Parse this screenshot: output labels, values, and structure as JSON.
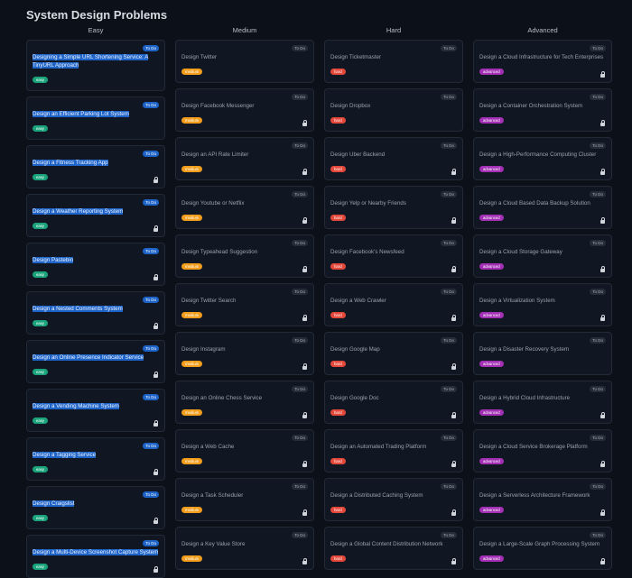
{
  "page_title": "System Design Problems",
  "todo_label": "To Do",
  "colors": {
    "easy": "#1ba47c",
    "medium": "#f29d1c",
    "hard": "#e4483b",
    "advanced": "#a22fb4"
  },
  "columns": [
    {
      "key": "easy",
      "heading": "Easy",
      "badge": "easy",
      "selected": true,
      "items": [
        {
          "title": "Designing a Simple URL Shortening Service: A TinyURL Approach",
          "locked": false
        },
        {
          "title": "Design an Efficient Parking Lot System",
          "locked": false
        },
        {
          "title": "Design a Fitness Tracking App",
          "locked": true
        },
        {
          "title": "Design a Weather Reporting System",
          "locked": true
        },
        {
          "title": "Design Pastebin",
          "locked": true
        },
        {
          "title": "Design a Nested Comments System",
          "locked": true
        },
        {
          "title": "Design an Online Presence Indicator Service",
          "locked": true
        },
        {
          "title": "Design a Vending Machine System",
          "locked": true
        },
        {
          "title": "Design a Tagging Service",
          "locked": true
        },
        {
          "title": "Design Craigslist",
          "locked": true
        },
        {
          "title": "Design a Multi-Device Screenshot Capture System",
          "locked": true
        }
      ]
    },
    {
      "key": "medium",
      "heading": "Medium",
      "badge": "medium",
      "selected": false,
      "items": [
        {
          "title": "Design Twitter",
          "locked": false
        },
        {
          "title": "Design Facebook Messenger",
          "locked": true
        },
        {
          "title": "Design an API Rate Limiter",
          "locked": true
        },
        {
          "title": "Design Youtube or Netflix",
          "locked": true
        },
        {
          "title": "Design Typeahead Suggestion",
          "locked": true
        },
        {
          "title": "Design Twitter Search",
          "locked": true
        },
        {
          "title": "Design Instagram",
          "locked": true
        },
        {
          "title": "Design an Online Chess Service",
          "locked": true
        },
        {
          "title": "Design a Web Cache",
          "locked": true
        },
        {
          "title": "Design a Task Scheduler",
          "locked": true
        },
        {
          "title": "Design a Key Value Store",
          "locked": true
        }
      ]
    },
    {
      "key": "hard",
      "heading": "Hard",
      "badge": "hard",
      "selected": false,
      "items": [
        {
          "title": "Design Ticketmaster",
          "locked": false
        },
        {
          "title": "Design Dropbox",
          "locked": false
        },
        {
          "title": "Design Uber Backend",
          "locked": true
        },
        {
          "title": "Design Yelp or Nearby Friends",
          "locked": true
        },
        {
          "title": "Design Facebook's Newsfeed",
          "locked": true
        },
        {
          "title": "Design a Web Crawler",
          "locked": true
        },
        {
          "title": "Design Google Map",
          "locked": true
        },
        {
          "title": "Design Google Doc",
          "locked": true
        },
        {
          "title": "Design an Automated Trading Platform",
          "locked": true
        },
        {
          "title": "Design a Distributed Caching System",
          "locked": true
        },
        {
          "title": "Design a Global Content Distribution Network",
          "locked": true
        }
      ]
    },
    {
      "key": "advanced",
      "heading": "Advanced",
      "badge": "advanced",
      "selected": false,
      "items": [
        {
          "title": "Design a Cloud Infrastructure for Tech Enterprises",
          "locked": true
        },
        {
          "title": "Design a Container Orchestration System",
          "locked": true
        },
        {
          "title": "Design a High-Performance Computing Cluster",
          "locked": true
        },
        {
          "title": "Design a Cloud Based Data Backup Solution",
          "locked": true
        },
        {
          "title": "Design a Cloud Storage Gateway",
          "locked": true
        },
        {
          "title": "Design a Virtualization System",
          "locked": true
        },
        {
          "title": "Design a Disaster Recovery System",
          "locked": false
        },
        {
          "title": "Design a Hybrid Cloud Infrastructure",
          "locked": true
        },
        {
          "title": "Design a Cloud Service Brokerage Platform",
          "locked": true
        },
        {
          "title": "Design a Serverless Architecture Framework",
          "locked": true
        },
        {
          "title": "Design a Large-Scale Graph Processing System",
          "locked": true
        }
      ]
    }
  ]
}
